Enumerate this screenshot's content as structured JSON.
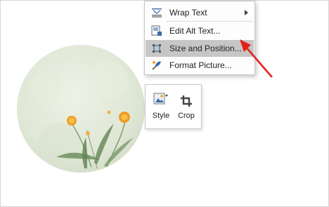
{
  "context_menu": {
    "items": [
      {
        "label": "Wrap Text",
        "icon": "wrap-text-icon",
        "has_submenu": true
      },
      {
        "label": "Edit Alt Text...",
        "icon": "edit-alt-text-icon"
      },
      {
        "label": "Size and Position...",
        "icon": "size-position-icon",
        "highlighted": true
      },
      {
        "label": "Format Picture...",
        "icon": "format-picture-icon"
      }
    ]
  },
  "mini_toolbar": {
    "style_label": "Style",
    "crop_label": "Crop"
  },
  "colors": {
    "highlight": "#c6c6c6",
    "annotation_arrow": "#e2231a",
    "flower": "#f0a028"
  }
}
